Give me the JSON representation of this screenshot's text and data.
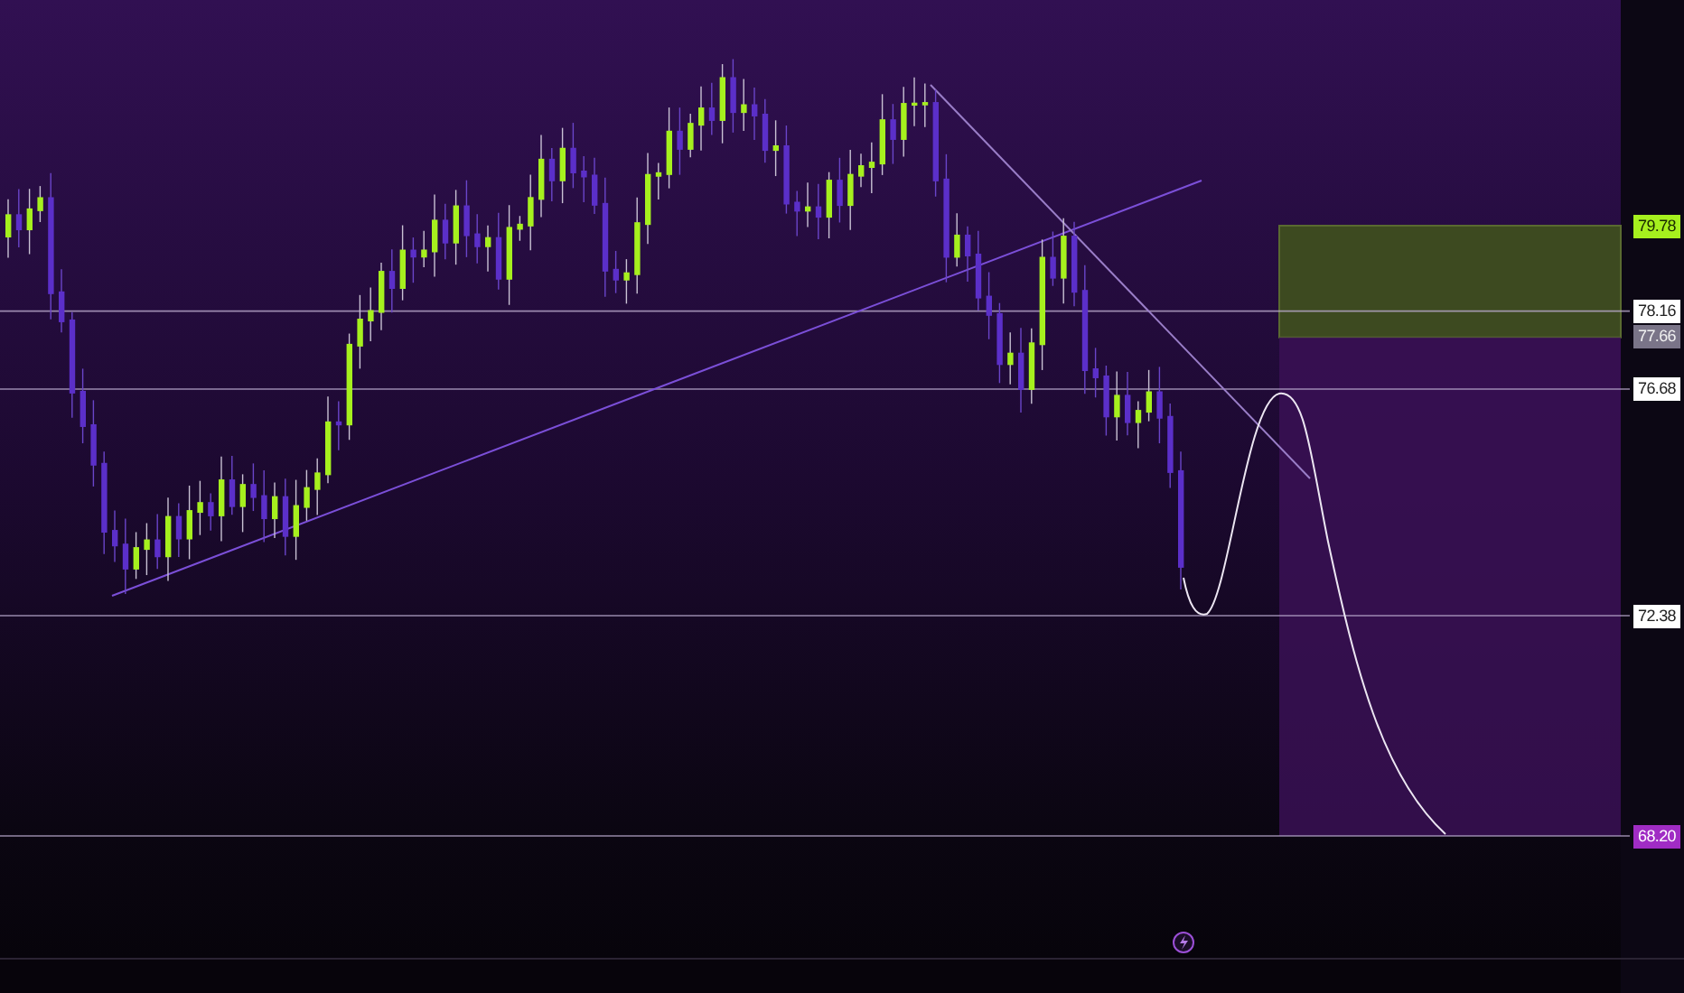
{
  "chart": {
    "price_tags": [
      {
        "label": "79.78",
        "kind": "target",
        "color": "#a6f01e"
      },
      {
        "label": "78.16",
        "kind": "level",
        "color": "#ffffff"
      },
      {
        "label": "77.66",
        "kind": "entry",
        "color": "#7a7488"
      },
      {
        "label": "76.68",
        "kind": "level",
        "color": "#ffffff"
      },
      {
        "label": "72.38",
        "kind": "level",
        "color": "#ffffff"
      },
      {
        "label": "68.20",
        "kind": "stop",
        "color": "#a02cc4"
      }
    ]
  }
}
